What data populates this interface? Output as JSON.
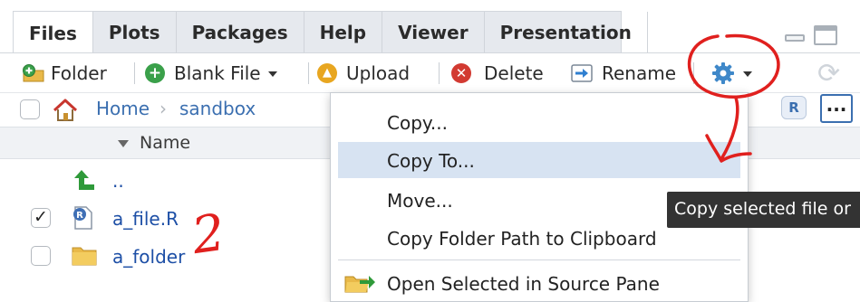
{
  "tabs": [
    {
      "label": "Files",
      "active": true
    },
    {
      "label": "Plots",
      "active": false
    },
    {
      "label": "Packages",
      "active": false
    },
    {
      "label": "Help",
      "active": false
    },
    {
      "label": "Viewer",
      "active": false
    },
    {
      "label": "Presentation",
      "active": false
    }
  ],
  "toolbar": {
    "folder_label": "Folder",
    "blank_file_label": "Blank File",
    "upload_label": "Upload",
    "delete_label": "Delete",
    "rename_label": "Rename"
  },
  "path": {
    "home_label": "Home",
    "separator": "›",
    "folder_label": "sandbox",
    "r_badge": "R",
    "more_label": "..."
  },
  "list": {
    "name_header": "Name",
    "rows": [
      {
        "name": "..",
        "checked": false,
        "type": "parent"
      },
      {
        "name": "a_file.R",
        "checked": true,
        "type": "r-file"
      },
      {
        "name": "a_folder",
        "checked": false,
        "type": "folder"
      }
    ]
  },
  "menu": {
    "items": [
      {
        "label": "Copy...",
        "highlighted": false
      },
      {
        "label": "Copy To...",
        "highlighted": true
      },
      {
        "label": "Move...",
        "highlighted": false
      },
      {
        "label": "Copy Folder Path to Clipboard",
        "highlighted": false
      },
      {
        "label": "Open Selected in Source Pane",
        "highlighted": false
      }
    ]
  },
  "tooltip": {
    "text": "Copy selected file or"
  },
  "annotations": {
    "number": "2",
    "color": "#e0201e"
  },
  "colors": {
    "link": "#1d4fa6",
    "accent": "#3b6fb0",
    "highlight": "#d7e3f2",
    "tab_strip": "#e6e9ee"
  }
}
